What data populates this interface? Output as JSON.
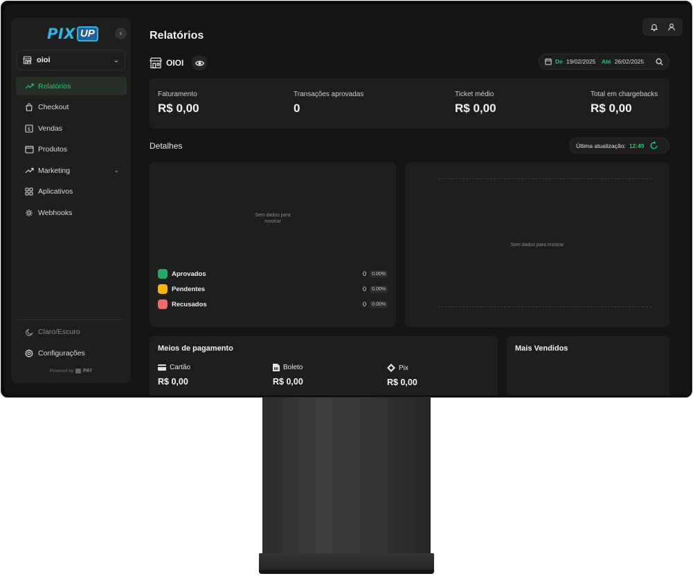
{
  "sidebar": {
    "logo_left": "PIX",
    "logo_right": "UP",
    "store_select": "oioi",
    "nav": [
      {
        "label": "Relatórios",
        "icon": "trending-up-icon",
        "active": true
      },
      {
        "label": "Checkout",
        "icon": "bag-icon"
      },
      {
        "label": "Vendas",
        "icon": "dollar-square-icon"
      },
      {
        "label": "Produtos",
        "icon": "box-icon"
      },
      {
        "label": "Marketing",
        "icon": "trending-up-icon",
        "has_submenu": true
      },
      {
        "label": "Aplicativos",
        "icon": "grid-icon"
      },
      {
        "label": "Webhooks",
        "icon": "webhook-icon"
      }
    ],
    "theme_label": "Claro/Escuro",
    "config_label": "Configurações",
    "powered_by": "Powered by",
    "powered_brand": "PAY"
  },
  "header": {
    "title": "Relatórios",
    "store_name": "OIOI"
  },
  "date_filter": {
    "from_label": "De",
    "from_value": "19/02/2025",
    "to_label": "Até",
    "to_value": "26/02/2025"
  },
  "metrics": [
    {
      "label": "Faturamento",
      "value": "R$ 0,00"
    },
    {
      "label": "Transações aprovadas",
      "value": "0"
    },
    {
      "label": "Ticket médio",
      "value": "R$ 0,00"
    },
    {
      "label": "Total em chargebacks",
      "value": "R$ 0,00"
    }
  ],
  "details": {
    "title": "Detalhes",
    "last_update_label": "Última atualização:",
    "last_update_time": "12:49",
    "donut_empty_line1": "Sem dados para",
    "donut_empty_line2": "mostrar",
    "chart_empty": "Sem dados para mostrar",
    "legend": [
      {
        "label": "Aprovados",
        "count": "0",
        "pct": "0.00%",
        "color": "#22a860"
      },
      {
        "label": "Pendentes",
        "count": "0",
        "pct": "0.00%",
        "color": "#f5b50a"
      },
      {
        "label": "Recusados",
        "count": "0",
        "pct": "0.00%",
        "color": "#ef6b6b"
      }
    ]
  },
  "payments": {
    "title": "Meios de pagamento",
    "methods": [
      {
        "label": "Cartão",
        "value": "R$ 0,00",
        "icon": "credit-card-icon"
      },
      {
        "label": "Boleto",
        "value": "R$ 0,00",
        "icon": "boleto-icon"
      },
      {
        "label": "Pix",
        "value": "R$ 0,00",
        "icon": "pix-icon"
      }
    ]
  },
  "top_sellers": {
    "title": "Mais Vendidos"
  },
  "colors": {
    "accent": "#1fc774",
    "background": "#141414",
    "panel": "#1e1e1e"
  }
}
